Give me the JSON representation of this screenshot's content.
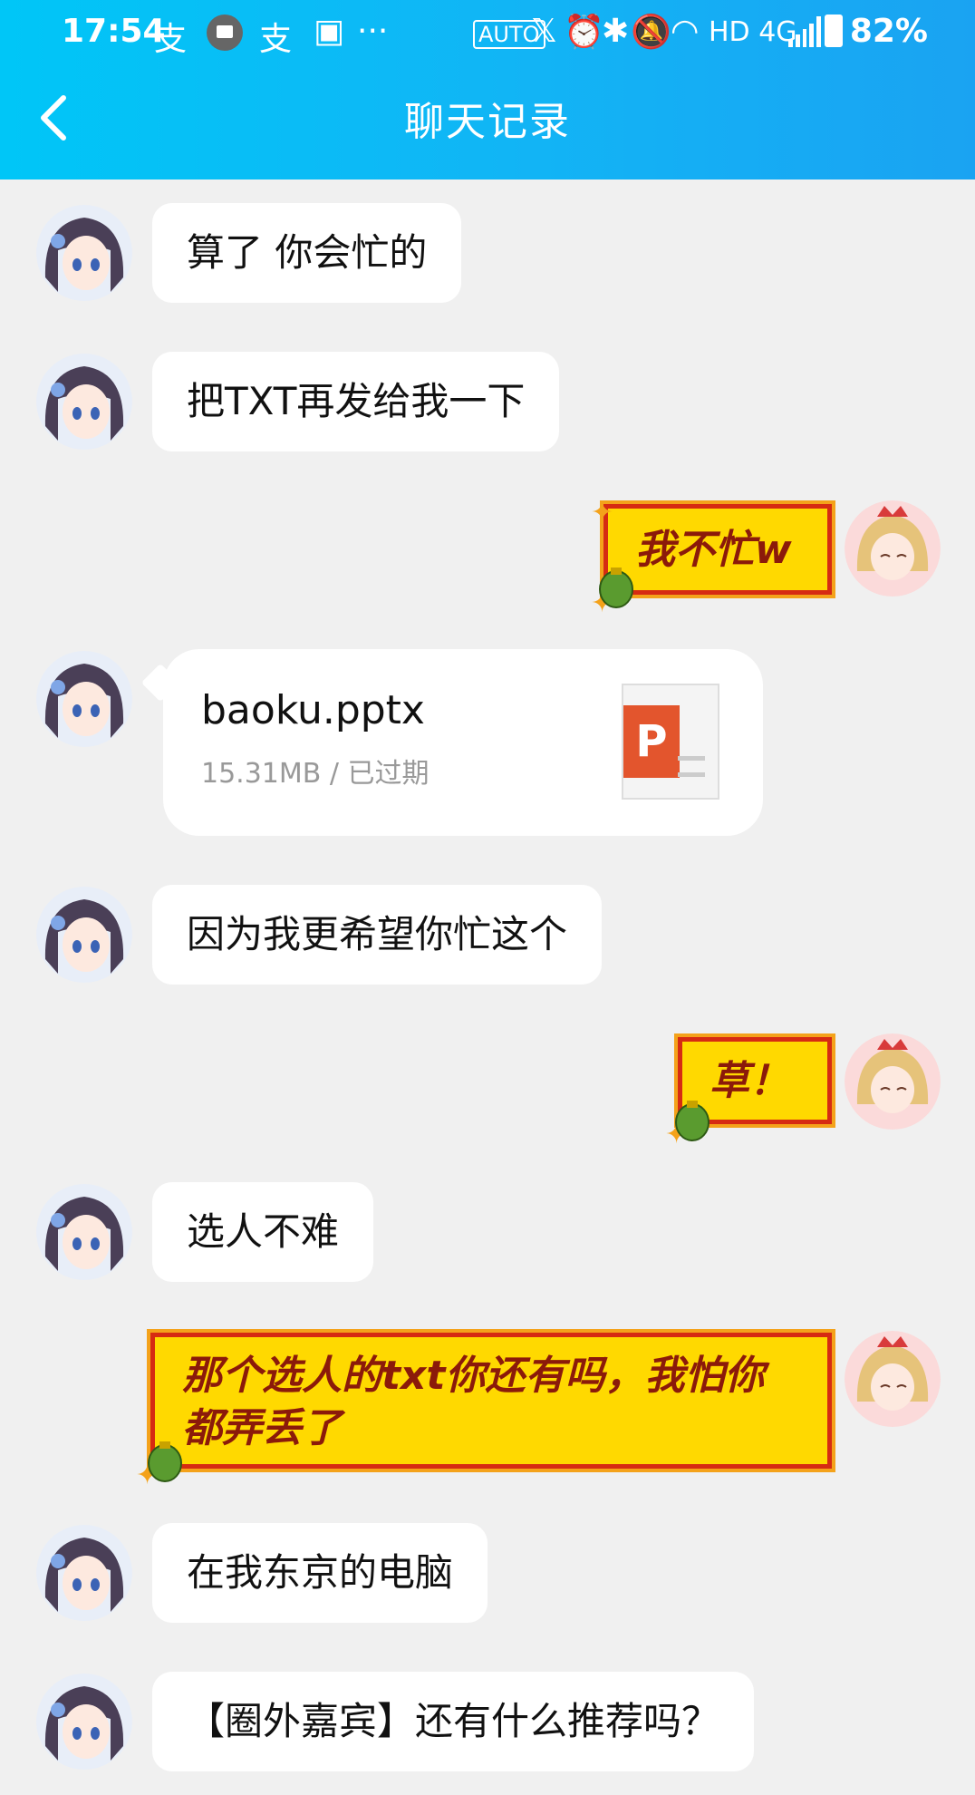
{
  "status_bar": {
    "time": "17:54",
    "icons_left": [
      "alipay-icon",
      "mail-notification-icon",
      "alipay-icon",
      "image-icon"
    ],
    "more": "···",
    "network": "HD 4G",
    "battery": "82%"
  },
  "header": {
    "title": "聊天记录",
    "back_icon": "chevron-left-icon"
  },
  "messages": [
    {
      "side": "left",
      "type": "text",
      "text": "算了 你会忙的"
    },
    {
      "side": "left",
      "type": "text",
      "text": "把TXT再发给我一下"
    },
    {
      "side": "right",
      "type": "sticker-text",
      "text": "我不忙w"
    },
    {
      "side": "left",
      "type": "file",
      "file_name": "baoku.pptx",
      "file_meta": "15.31MB / 已过期",
      "file_icon": "ppt-icon",
      "icon_letter": "P"
    },
    {
      "side": "left",
      "type": "text",
      "text": "因为我更希望你忙这个"
    },
    {
      "side": "right",
      "type": "sticker-text",
      "text": "草！"
    },
    {
      "side": "left",
      "type": "text",
      "text": "选人不难"
    },
    {
      "side": "right",
      "type": "sticker-text",
      "text_line1": "那个选人的txt你还有吗，我怕你",
      "text_line2": "都弄丢了"
    },
    {
      "side": "left",
      "type": "text",
      "text": "在我东京的电脑"
    },
    {
      "side": "left",
      "type": "text",
      "text": "【圈外嘉宾】还有什么推荐吗？"
    }
  ],
  "colors": {
    "header_start": "#00c6f7",
    "header_end": "#1aa3f2",
    "background": "#f0f0f0",
    "sticker_fill": "#ffd900",
    "sticker_text": "#8b1a0a",
    "ppt_orange": "#e3552d"
  }
}
